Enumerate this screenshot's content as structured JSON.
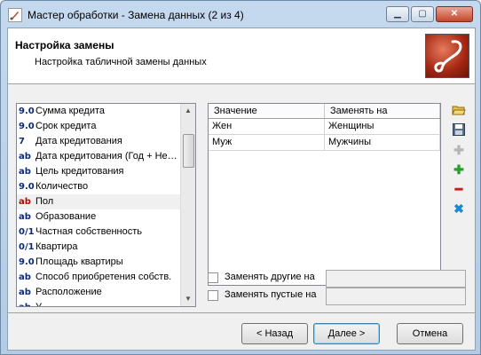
{
  "window": {
    "title": "Мастер обработки - Замена данных (2 из 4)"
  },
  "header": {
    "title": "Настройка замены",
    "subtitle": "Настройка табличной замены данных"
  },
  "fields": [
    {
      "type": "9.0",
      "label": "Сумма кредита"
    },
    {
      "type": "9.0",
      "label": "Срок кредита"
    },
    {
      "type": "7",
      "label": "Дата кредитования"
    },
    {
      "type": "ab",
      "label": "Дата кредитования (Год + Не…"
    },
    {
      "type": "ab",
      "label": "Цель кредитования"
    },
    {
      "type": "9.0",
      "label": "Количество"
    },
    {
      "type": "ab",
      "label": "Пол",
      "selected": true
    },
    {
      "type": "ab",
      "label": "Образование"
    },
    {
      "type": "0/1",
      "label": "Частная собственность"
    },
    {
      "type": "0/1",
      "label": "Квартира"
    },
    {
      "type": "9.0",
      "label": "Площадь квартиры"
    },
    {
      "type": "ab",
      "label": "Способ приобретения собств."
    },
    {
      "type": "ab",
      "label": "Расположение"
    },
    {
      "type": "ab",
      "label": "У…"
    }
  ],
  "grid": {
    "columns": [
      "Значение",
      "Заменять на"
    ],
    "rows": [
      [
        "Жен",
        "Женщины"
      ],
      [
        "Муж",
        "Мужчины"
      ]
    ]
  },
  "tools": [
    "open-folder-icon",
    "save-icon",
    "add-many-icon",
    "add-icon",
    "remove-icon",
    "clear-icon"
  ],
  "options": {
    "replace_other_label": "Заменять другие на",
    "replace_empty_label": "Заменять пустые на",
    "replace_other_value": "",
    "replace_empty_value": ""
  },
  "buttons": {
    "back": "< Назад",
    "next": "Далее >",
    "cancel": "Отмена"
  },
  "colors": {
    "accent": "#c00000",
    "type_icon": "#0b2a7a",
    "add": "#2a9d2a",
    "remove": "#c81e1e",
    "clear": "#1a8ac8"
  }
}
